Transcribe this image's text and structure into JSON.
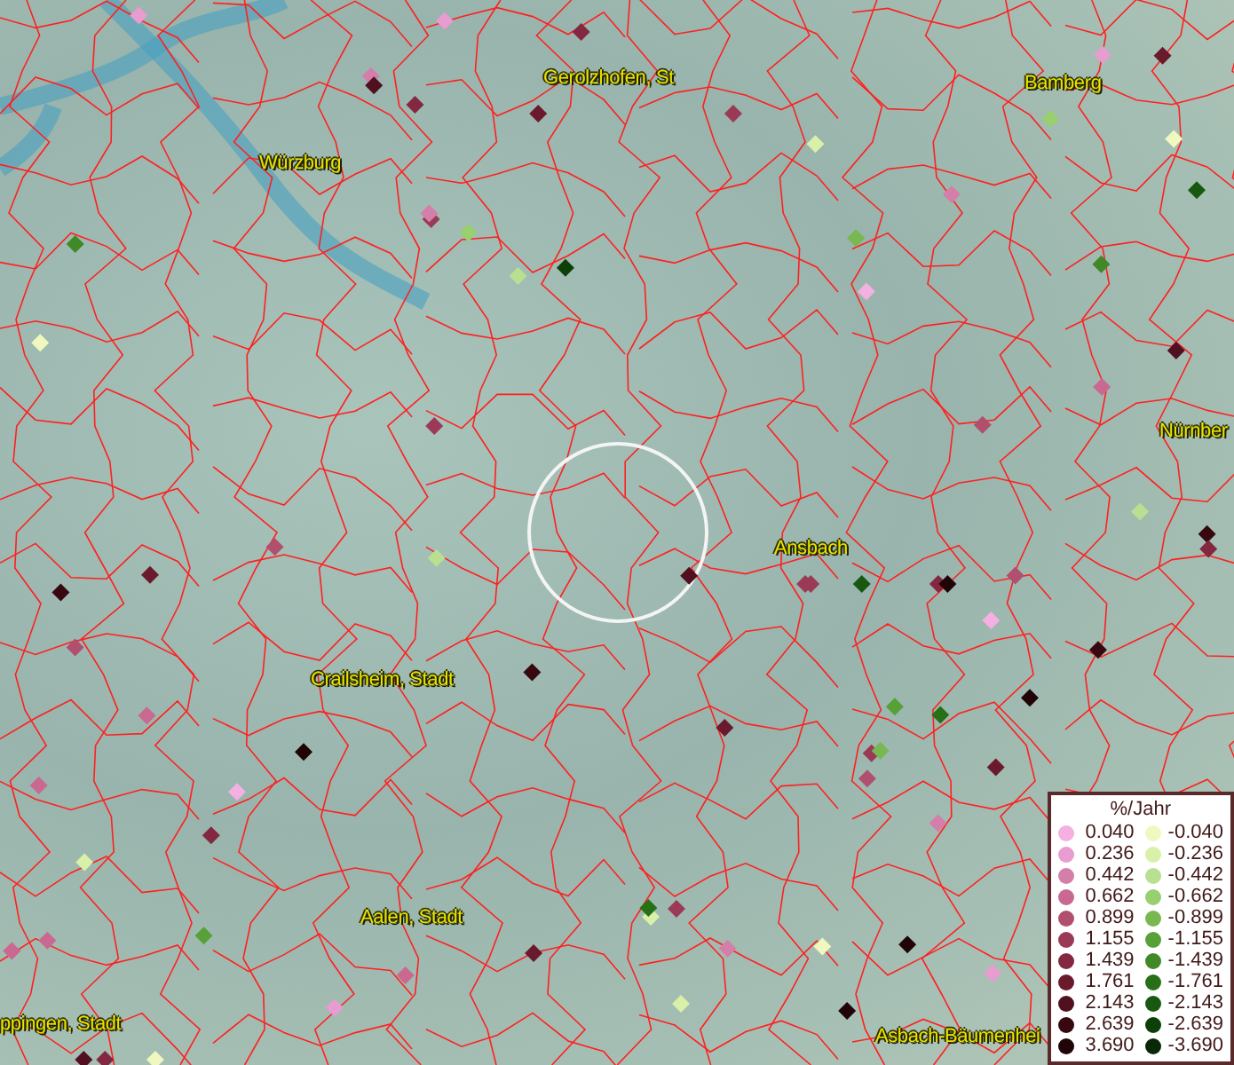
{
  "place_labels": [
    {
      "text": "Würzburg"
    },
    {
      "text": "Gerolzhofen, St"
    },
    {
      "text": "Bamberg"
    },
    {
      "text": "Nürnber"
    },
    {
      "text": "Ansbach"
    },
    {
      "text": "Crailsheim, Stadt"
    },
    {
      "text": "Aalen, Stadt"
    },
    {
      "text": "ppingen, Stadt"
    },
    {
      "text": "Asbach-Bäumenhei"
    }
  ],
  "markers": [
    {
      "color": "#e89cd0"
    },
    {
      "color": "#6a1a2c"
    },
    {
      "color": "#d8f0a8"
    },
    {
      "color": "#9a3a56"
    },
    {
      "color": "#200408"
    },
    {
      "color": "#58a038"
    },
    {
      "color": "#c96890"
    },
    {
      "color": "#f0f8c0"
    },
    {
      "color": "#822840"
    },
    {
      "color": "#d47eaa"
    },
    {
      "color": "#380810"
    },
    {
      "color": "#b8e090"
    },
    {
      "color": "#b0506e"
    },
    {
      "color": "#287018"
    },
    {
      "color": "#f4b0e0"
    },
    {
      "color": "#501020"
    },
    {
      "color": "#9a3a56"
    },
    {
      "color": "#98d070"
    },
    {
      "color": "#6a1a2c"
    },
    {
      "color": "#e89cd0"
    },
    {
      "color": "#c96890"
    },
    {
      "color": "#185810"
    },
    {
      "color": "#d8f0a8"
    },
    {
      "color": "#822840"
    },
    {
      "color": "#200408"
    },
    {
      "color": "#d47eaa"
    },
    {
      "color": "#78b850"
    },
    {
      "color": "#b0506e"
    },
    {
      "color": "#380810"
    },
    {
      "color": "#f0f8c0"
    },
    {
      "color": "#9a3a56"
    },
    {
      "color": "#408828"
    },
    {
      "color": "#501020"
    },
    {
      "color": "#c96890"
    },
    {
      "color": "#e89cd0"
    },
    {
      "color": "#6a1a2c"
    },
    {
      "color": "#b8e090"
    },
    {
      "color": "#822840"
    },
    {
      "color": "#0c4008"
    },
    {
      "color": "#d47eaa"
    },
    {
      "color": "#200408"
    },
    {
      "color": "#b0506e"
    },
    {
      "color": "#d8f0a8"
    },
    {
      "color": "#9a3a56"
    },
    {
      "color": "#58a038"
    },
    {
      "color": "#f4b0e0"
    },
    {
      "color": "#380810"
    },
    {
      "color": "#c96890"
    },
    {
      "color": "#6a1a2c"
    },
    {
      "color": "#98d070"
    },
    {
      "color": "#822840"
    },
    {
      "color": "#e89cd0"
    },
    {
      "color": "#501020"
    },
    {
      "color": "#f0f8c0"
    },
    {
      "color": "#b0506e"
    },
    {
      "color": "#287018"
    },
    {
      "color": "#9a3a56"
    },
    {
      "color": "#d47eaa"
    },
    {
      "color": "#200408"
    },
    {
      "color": "#b8e090"
    },
    {
      "color": "#6a1a2c"
    },
    {
      "color": "#c96890"
    },
    {
      "color": "#822840"
    },
    {
      "color": "#78b850"
    },
    {
      "color": "#380810"
    },
    {
      "color": "#e89cd0"
    },
    {
      "color": "#9a3a56"
    },
    {
      "color": "#d8f0a8"
    },
    {
      "color": "#501020"
    },
    {
      "color": "#b0506e"
    },
    {
      "color": "#185810"
    },
    {
      "color": "#d47eaa"
    },
    {
      "color": "#6a1a2c"
    },
    {
      "color": "#f4b0e0"
    },
    {
      "color": "#822840"
    },
    {
      "color": "#408828"
    },
    {
      "color": "#200408"
    },
    {
      "color": "#c96890"
    },
    {
      "color": "#f0f8c0"
    },
    {
      "color": "#9a3a56"
    }
  ],
  "legend": {
    "title": "%/Jahr",
    "rows": [
      {
        "positive": {
          "value": "0.040",
          "color": "#f4b0e0"
        },
        "negative": {
          "value": "-0.040",
          "color": "#f0f8c0"
        }
      },
      {
        "positive": {
          "value": "0.236",
          "color": "#e89cd0"
        },
        "negative": {
          "value": "-0.236",
          "color": "#d8f0a8"
        }
      },
      {
        "positive": {
          "value": "0.442",
          "color": "#d47eaa"
        },
        "negative": {
          "value": "-0.442",
          "color": "#b8e090"
        }
      },
      {
        "positive": {
          "value": "0.662",
          "color": "#c96890"
        },
        "negative": {
          "value": "-0.662",
          "color": "#98d070"
        }
      },
      {
        "positive": {
          "value": "0.899",
          "color": "#b0506e"
        },
        "negative": {
          "value": "-0.899",
          "color": "#78b850"
        }
      },
      {
        "positive": {
          "value": "1.155",
          "color": "#9a3a56"
        },
        "negative": {
          "value": "-1.155",
          "color": "#58a038"
        }
      },
      {
        "positive": {
          "value": "1.439",
          "color": "#822840"
        },
        "negative": {
          "value": "-1.439",
          "color": "#408828"
        }
      },
      {
        "positive": {
          "value": "1.761",
          "color": "#6a1a2c"
        },
        "negative": {
          "value": "-1.761",
          "color": "#287018"
        }
      },
      {
        "positive": {
          "value": "2.143",
          "color": "#501020"
        },
        "negative": {
          "value": "-2.143",
          "color": "#185810"
        }
      },
      {
        "positive": {
          "value": "2.639",
          "color": "#380810"
        },
        "negative": {
          "value": "-2.639",
          "color": "#0c4008"
        }
      },
      {
        "positive": {
          "value": "3.690",
          "color": "#200408"
        },
        "negative": {
          "value": "-3.690",
          "color": "#082808"
        }
      }
    ]
  }
}
